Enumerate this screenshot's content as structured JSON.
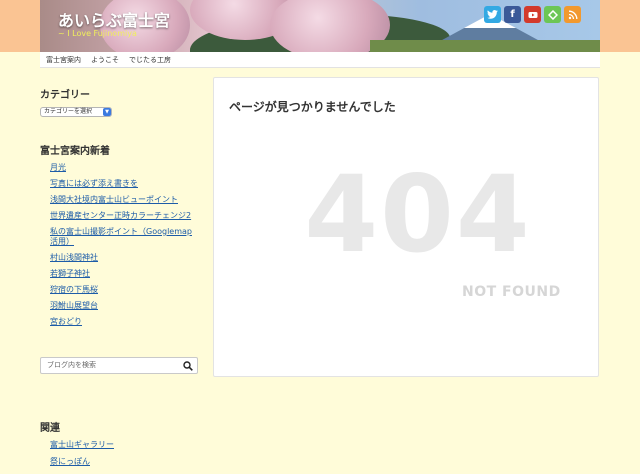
{
  "header": {
    "site_title": "あいらぶ富士宮",
    "subtitle": "~ I Love Fujinomiya"
  },
  "social": {
    "icons": [
      "twitter-icon",
      "facebook-icon",
      "youtube-icon",
      "feedly-icon",
      "rss-icon"
    ],
    "colors": [
      "#33a9e3",
      "#3b5998",
      "#d33a2c",
      "#6cc655",
      "#f2992e"
    ]
  },
  "nav": {
    "items": [
      "富士宮案内",
      "ようこそ",
      "でじたる工房"
    ]
  },
  "sidebar": {
    "category_title": "カテゴリー",
    "category_select": "カテゴリーを選択",
    "recent_title": "富士宮案内新着",
    "recent_posts": [
      "月光",
      "写真には必ず添え書きを",
      "浅間大社境内富士山ビューポイント",
      "世界遺産センター正時カラーチェンジ2",
      "私の富士山撮影ポイント（Googlemap 活用）",
      "村山浅間神社",
      "若獅子神社",
      "狩宿の下馬桜",
      "羽鮒山展望台",
      "宮おどり"
    ],
    "search_placeholder": "ブログ内を検索",
    "related_title": "関連",
    "related_links": [
      "富士山ギャラリー",
      "祭にっぽん"
    ]
  },
  "main": {
    "title": "ページが見つかりませんでした",
    "error_code": "404",
    "error_text": "NOT FOUND"
  }
}
